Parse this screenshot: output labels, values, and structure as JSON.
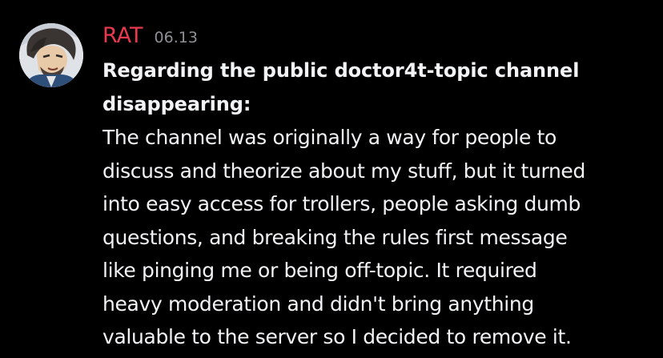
{
  "message": {
    "author": "RAT",
    "timestamp": "06.13",
    "author_color": "#e8394e",
    "avatar_icon": "user-avatar",
    "heading_lines": [
      "Regarding the public doctor4t-topic channel",
      "disappearing:"
    ],
    "body_lines": [
      "The channel was originally a way for people to",
      "discuss and theorize about my stuff, but it turned",
      "into easy access for trollers, people asking dumb",
      "questions, and breaking the rules first message",
      "like pinging me or being off-topic. It required",
      "heavy moderation and didn't bring anything",
      "valuable to the server so I decided to remove it."
    ]
  }
}
